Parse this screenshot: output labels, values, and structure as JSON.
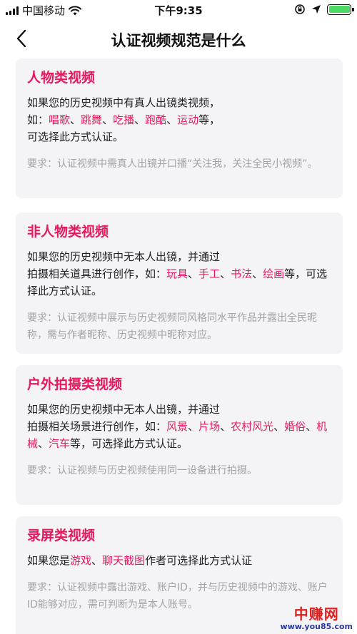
{
  "status_bar": {
    "carrier": "中国移动",
    "time": "下午9:35",
    "battery_percent": 100
  },
  "nav": {
    "title": "认证视频规范是什么"
  },
  "cards": [
    {
      "title": "人物类视频",
      "body": [
        {
          "t": "如果您的历史视频中有真人出镜类视频，"
        },
        {
          "br": true
        },
        {
          "t": "如："
        },
        {
          "t": "唱歌",
          "hl": true
        },
        {
          "t": "、"
        },
        {
          "t": "跳舞",
          "hl": true
        },
        {
          "t": "、"
        },
        {
          "t": "吃播",
          "hl": true
        },
        {
          "t": "、"
        },
        {
          "t": "跑酷",
          "hl": true
        },
        {
          "t": "、"
        },
        {
          "t": "运动",
          "hl": true
        },
        {
          "t": "等，"
        },
        {
          "br": true
        },
        {
          "t": "可选择此方式认证。"
        }
      ],
      "requirement": "要求：认证视频中需真人出镜并口播“关注我，关注全民小视频”。"
    },
    {
      "title": "非人物类视频",
      "body": [
        {
          "t": "如果您的历史视频中无本人出镜，并通过"
        },
        {
          "br": true
        },
        {
          "t": "拍摄相关道具进行创作，如："
        },
        {
          "t": "玩具",
          "hl": true
        },
        {
          "t": "、"
        },
        {
          "t": "手工",
          "hl": true
        },
        {
          "t": "、"
        },
        {
          "t": "书法",
          "hl": true
        },
        {
          "t": "、"
        },
        {
          "t": "绘画",
          "hl": true
        },
        {
          "t": "等，可选择此方式认证。"
        }
      ],
      "requirement": "要求：认证视频中展示与历史视频同风格同水平作品并露出全民昵称，需与作者昵称、历史视频中昵称对应。"
    },
    {
      "title": "户外拍摄类视频",
      "body": [
        {
          "t": "如果您的历史视频中无本人出镜，并通过"
        },
        {
          "br": true
        },
        {
          "t": "拍摄相关场景进行创作，如："
        },
        {
          "t": "风景",
          "hl": true
        },
        {
          "t": "、"
        },
        {
          "t": "片场",
          "hl": true
        },
        {
          "t": "、"
        },
        {
          "t": "农村风光",
          "hl": true
        },
        {
          "t": "、"
        },
        {
          "t": "婚俗",
          "hl": true
        },
        {
          "t": "、"
        },
        {
          "t": "机械",
          "hl": true
        },
        {
          "t": "、"
        },
        {
          "t": "汽车",
          "hl": true
        },
        {
          "t": "等，可选择此方式认证。"
        }
      ],
      "requirement": "要求：认证视频与历史视频使用同一设备进行拍摄。"
    },
    {
      "title": "录屏类视频",
      "body": [
        {
          "t": "如果您是"
        },
        {
          "t": "游戏",
          "hl": true
        },
        {
          "t": "、"
        },
        {
          "t": "聊天截图",
          "hl": true
        },
        {
          "t": "作者可选择此方式认证"
        }
      ],
      "requirement": "要求：认证视频中露出游戏、账户ID，并与历史视频中的游戏、账户ID能够对应，需可判断为是本人账号。"
    }
  ],
  "watermark": {
    "name": "中赚网",
    "url": "www.you85.com"
  },
  "colors": {
    "accent": "#e8185c",
    "card_bg": "#f4f4f6",
    "requirement_text": "#a3a3a8"
  }
}
